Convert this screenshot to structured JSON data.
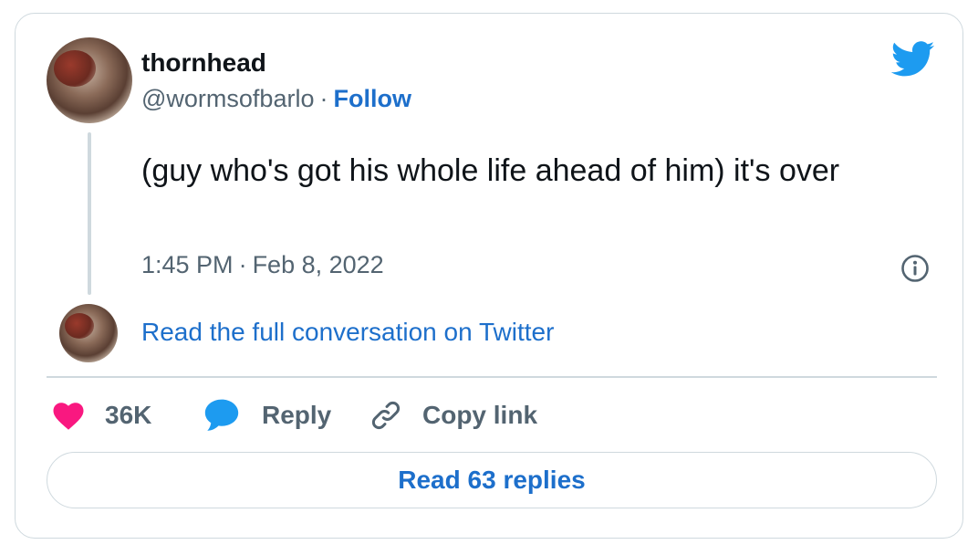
{
  "tweet": {
    "author": {
      "display_name": "thornhead",
      "handle": "@wormsofbarlo",
      "separator": "·",
      "follow_label": "Follow"
    },
    "text": "(guy who's got his whole life ahead of him) it's over",
    "time": "1:45 PM",
    "date": "Feb 8, 2022",
    "meta_separator": "·",
    "conversation_link": "Read the full conversation on Twitter"
  },
  "actions": {
    "like_count": "36K",
    "reply_label": "Reply",
    "copy_link_label": "Copy link"
  },
  "replies_button_label": "Read 63 replies",
  "icons": {
    "brand": "twitter-bird-icon",
    "info": "info-icon",
    "like": "heart-icon",
    "reply": "speech-bubble-icon",
    "copy": "link-icon"
  },
  "colors": {
    "twitter_blue": "#1d9bf0",
    "link_blue": "#1d6fcb",
    "heart_pink": "#f91880",
    "text_primary": "#0f1419",
    "text_secondary": "#536471",
    "border": "#cfd9de"
  }
}
